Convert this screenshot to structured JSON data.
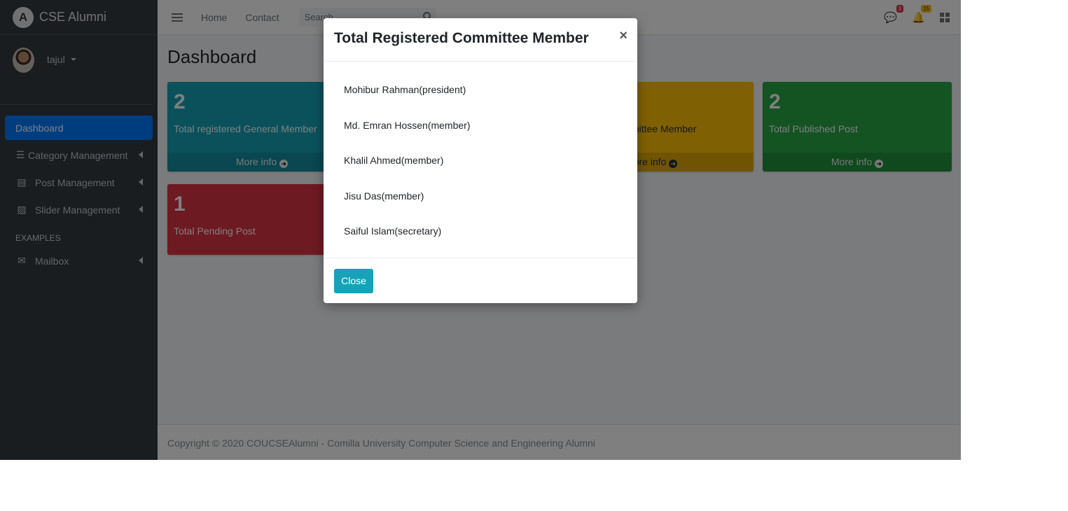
{
  "brand": {
    "name": "CSE Alumni"
  },
  "user": {
    "name": "tajul"
  },
  "sidebar": {
    "items": [
      {
        "label": "Dashboard",
        "icon": "none",
        "active": true
      },
      {
        "label": "Category Management",
        "icon": "list-icon"
      },
      {
        "label": "Post Management",
        "icon": "newspaper-icon"
      },
      {
        "label": "Slider Management",
        "icon": "image-icon"
      }
    ],
    "section_header": "EXAMPLES",
    "examples": [
      {
        "label": "Mailbox",
        "icon": "envelope-icon"
      }
    ]
  },
  "topbar": {
    "links": [
      "Home",
      "Contact"
    ],
    "search_placeholder": "Search",
    "messages_badge": "3",
    "notifications_badge": "15"
  },
  "page": {
    "title": "Dashboard"
  },
  "boxes": [
    {
      "number": "2",
      "label": "Total registered General Member",
      "footer": "More info",
      "color": "#17a2b8"
    },
    {
      "number": "",
      "label": "mittee Member",
      "footer": "ore info",
      "color": "#ffc107"
    },
    {
      "number": "2",
      "label": "Total Published Post",
      "footer": "More info",
      "color": "#28a745"
    },
    {
      "number": "1",
      "label": "Total Pending Post",
      "footer": "",
      "color": "#dc3545"
    }
  ],
  "footer": {
    "text": "Copyright © 2020 COUCSEAlumni - Comilla University Computer Science and Engineering Alumni"
  },
  "modal": {
    "title": "Total Registered Committee Member",
    "close_symbol": "×",
    "members": [
      "Mohibur Rahman(president)",
      "Md. Emran Hossen(member)",
      "Khalil Ahmed(member)",
      "Jisu Das(member)",
      "Saiful Islam(secretary)"
    ],
    "button_label": "Close"
  }
}
